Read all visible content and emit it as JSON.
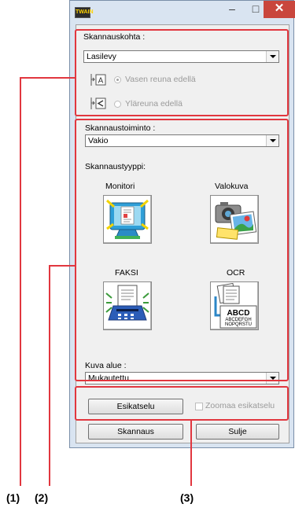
{
  "window": {
    "app_icon_text": "TWAIN",
    "minimize_glyph": "–",
    "maximize_glyph": "□",
    "close_glyph": "✕"
  },
  "scan_location": {
    "label": "Skannauskohta :",
    "value": "Lasilevy",
    "orientation_left": "Vasen reuna edellä",
    "orientation_top": "Yläreuna edellä"
  },
  "scan_function": {
    "label": "Skannaustoiminto :",
    "value": "Vakio"
  },
  "scan_type": {
    "label": "Skannaustyyppi:",
    "monitor": "Monitori",
    "photo": "Valokuva",
    "fax": "FAKSI",
    "ocr": "OCR",
    "ocr_text_1": "ABCD",
    "ocr_text_2": "ABCDEFGH",
    "ocr_text_3": "NOPQRSTU"
  },
  "image_area": {
    "label": "Kuva alue :",
    "value": "Mukautettu"
  },
  "buttons": {
    "preview": "Esikatselu",
    "zoom_preview": "Zoomaa esikatselu",
    "scan": "Skannaus",
    "close": "Sulje"
  },
  "callouts": {
    "c1": "(1)",
    "c2": "(2)",
    "c3": "(3)"
  },
  "colors": {
    "highlight": "#e1373f",
    "window_frame": "#d9e4f1",
    "close_button": "#c9463d"
  }
}
